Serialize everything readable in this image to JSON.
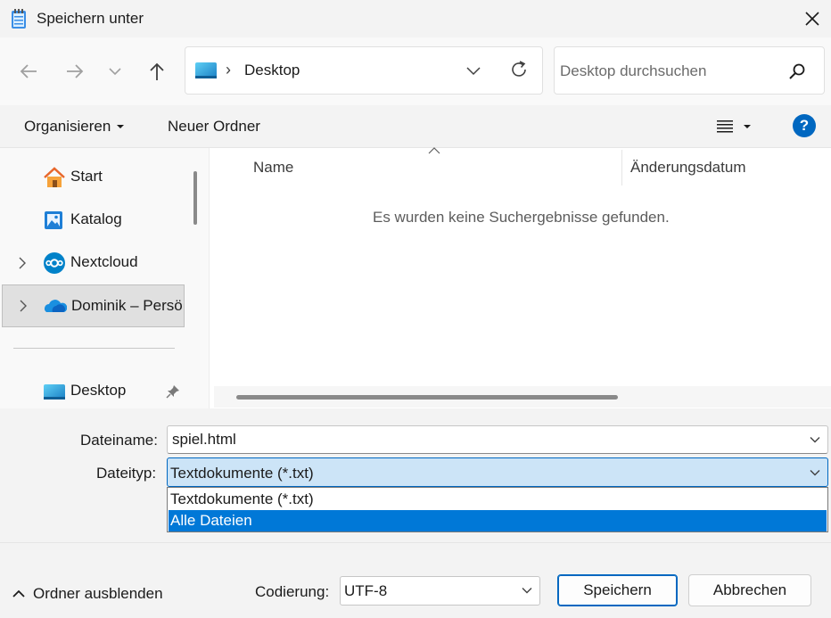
{
  "window": {
    "title": "Speichern unter",
    "title_icon": "notepad-icon",
    "close_icon": "close-icon"
  },
  "nav": {
    "back_icon": "arrow-left-icon",
    "forward_icon": "arrow-right-icon",
    "recent_icon": "chevron-down-icon",
    "up_icon": "arrow-up-icon",
    "address": {
      "folder_icon": "desktop-folder-icon",
      "separator": "›",
      "path": "Desktop"
    },
    "search": {
      "placeholder": "Desktop durchsuchen",
      "value": ""
    }
  },
  "command_bar": {
    "organize_label": "Organisieren",
    "new_folder_label": "Neuer Ordner",
    "view_icon": "list-view-icon",
    "help_label": "?"
  },
  "sidebar": {
    "items": [
      {
        "label": "Start",
        "icon": "home-icon",
        "expandable": false,
        "selected": false
      },
      {
        "label": "Katalog",
        "icon": "gallery-icon",
        "expandable": false,
        "selected": false
      },
      {
        "label": "Nextcloud",
        "icon": "nextcloud-icon",
        "expandable": true,
        "selected": false
      },
      {
        "label": "Dominik – Persö",
        "icon": "onedrive-icon",
        "expandable": true,
        "selected": true
      },
      {
        "label": "Desktop",
        "icon": "desktop-folder-icon",
        "expandable": false,
        "selected": false,
        "pinned": true
      }
    ]
  },
  "list": {
    "columns": [
      "Name",
      "Änderungsdatum"
    ],
    "empty_message": "Es wurden keine Suchergebnisse gefunden."
  },
  "form": {
    "filename_label": "Dateiname:",
    "filename_value": "spiel.html",
    "filetype_label": "Dateityp:",
    "filetype_value": "Textdokumente (*.txt)",
    "filetype_options": [
      "Textdokumente (*.txt)",
      "Alle Dateien"
    ],
    "filetype_highlighted_index": 1
  },
  "footer": {
    "hide_folders_label": "Ordner ausblenden",
    "encoding_label": "Codierung:",
    "encoding_value": "UTF-8",
    "save_label": "Speichern",
    "cancel_label": "Abbrechen"
  },
  "colors": {
    "accent": "#0067c0",
    "selection": "#0078d7",
    "select_fill": "#cce4f7"
  }
}
